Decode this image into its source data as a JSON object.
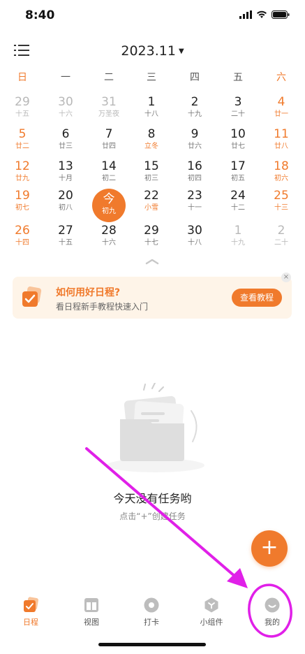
{
  "status_bar": {
    "time": "8:40"
  },
  "header": {
    "month_title": "2023.11"
  },
  "weekdays": [
    "日",
    "一",
    "二",
    "三",
    "四",
    "五",
    "六"
  ],
  "calendar": {
    "weeks": [
      [
        {
          "day": "29",
          "lunar": "十五",
          "other": true
        },
        {
          "day": "30",
          "lunar": "十六",
          "other": true
        },
        {
          "day": "31",
          "lunar": "万圣夜",
          "other": true
        },
        {
          "day": "1",
          "lunar": "十八"
        },
        {
          "day": "2",
          "lunar": "十九"
        },
        {
          "day": "3",
          "lunar": "二十"
        },
        {
          "day": "4",
          "lunar": "廿一"
        }
      ],
      [
        {
          "day": "5",
          "lunar": "廿二"
        },
        {
          "day": "6",
          "lunar": "廿三"
        },
        {
          "day": "7",
          "lunar": "廿四"
        },
        {
          "day": "8",
          "lunar": "立冬",
          "term": true
        },
        {
          "day": "9",
          "lunar": "廿六"
        },
        {
          "day": "10",
          "lunar": "廿七"
        },
        {
          "day": "11",
          "lunar": "廿八"
        }
      ],
      [
        {
          "day": "12",
          "lunar": "廿九"
        },
        {
          "day": "13",
          "lunar": "十月"
        },
        {
          "day": "14",
          "lunar": "初二"
        },
        {
          "day": "15",
          "lunar": "初三"
        },
        {
          "day": "16",
          "lunar": "初四"
        },
        {
          "day": "17",
          "lunar": "初五"
        },
        {
          "day": "18",
          "lunar": "初六"
        }
      ],
      [
        {
          "day": "19",
          "lunar": "初七"
        },
        {
          "day": "20",
          "lunar": "初八"
        },
        {
          "day": "今",
          "lunar": "初九",
          "today": true
        },
        {
          "day": "22",
          "lunar": "小雪",
          "term": true
        },
        {
          "day": "23",
          "lunar": "十一"
        },
        {
          "day": "24",
          "lunar": "十二"
        },
        {
          "day": "25",
          "lunar": "十三"
        }
      ],
      [
        {
          "day": "26",
          "lunar": "十四"
        },
        {
          "day": "27",
          "lunar": "十五"
        },
        {
          "day": "28",
          "lunar": "十六"
        },
        {
          "day": "29",
          "lunar": "十七"
        },
        {
          "day": "30",
          "lunar": "十八"
        },
        {
          "day": "1",
          "lunar": "十九",
          "other": true
        },
        {
          "day": "2",
          "lunar": "二十",
          "other": true
        }
      ]
    ]
  },
  "tip_card": {
    "title": "如何用好日程?",
    "subtitle": "看日程新手教程快速入门",
    "button": "查看教程",
    "close": "×"
  },
  "empty_state": {
    "title": "今天没有任务哟",
    "subtitle": "点击“+”创建任务"
  },
  "fab": {
    "label": "+"
  },
  "tabbar": [
    {
      "label": "日程",
      "icon": "calendar-icon",
      "active": true
    },
    {
      "label": "视图",
      "icon": "layout-icon"
    },
    {
      "label": "打卡",
      "icon": "checkin-icon"
    },
    {
      "label": "小组件",
      "icon": "widget-icon"
    },
    {
      "label": "我的",
      "icon": "profile-icon"
    }
  ],
  "colors": {
    "accent": "#f07a2c",
    "annotation": "#e020e8"
  }
}
